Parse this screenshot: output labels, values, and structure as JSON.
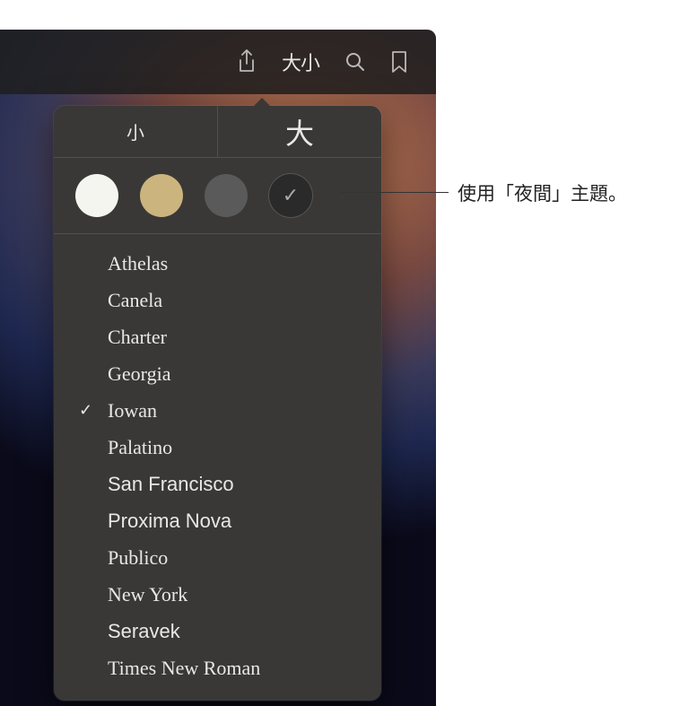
{
  "toolbar": {
    "text_size_label": "大小"
  },
  "size": {
    "small_label": "小",
    "large_label": "大"
  },
  "themes": [
    {
      "name": "white",
      "selected": false
    },
    {
      "name": "sepia",
      "selected": false
    },
    {
      "name": "gray",
      "selected": false
    },
    {
      "name": "night",
      "selected": true
    }
  ],
  "fonts": [
    {
      "label": "Athelas",
      "class": "font-athelas",
      "selected": false
    },
    {
      "label": "Canela",
      "class": "font-canela",
      "selected": false
    },
    {
      "label": "Charter",
      "class": "font-charter",
      "selected": false
    },
    {
      "label": "Georgia",
      "class": "font-georgia",
      "selected": false
    },
    {
      "label": "Iowan",
      "class": "font-iowan",
      "selected": true
    },
    {
      "label": "Palatino",
      "class": "font-palatino",
      "selected": false
    },
    {
      "label": "San Francisco",
      "class": "font-sf",
      "selected": false
    },
    {
      "label": "Proxima Nova",
      "class": "font-proxima",
      "selected": false
    },
    {
      "label": "Publico",
      "class": "font-publico",
      "selected": false
    },
    {
      "label": "New York",
      "class": "font-newyork",
      "selected": false
    },
    {
      "label": "Seravek",
      "class": "font-seravek",
      "selected": false
    },
    {
      "label": "Times New Roman",
      "class": "font-times",
      "selected": false
    }
  ],
  "callout": {
    "text": "使用「夜間」主題。"
  }
}
